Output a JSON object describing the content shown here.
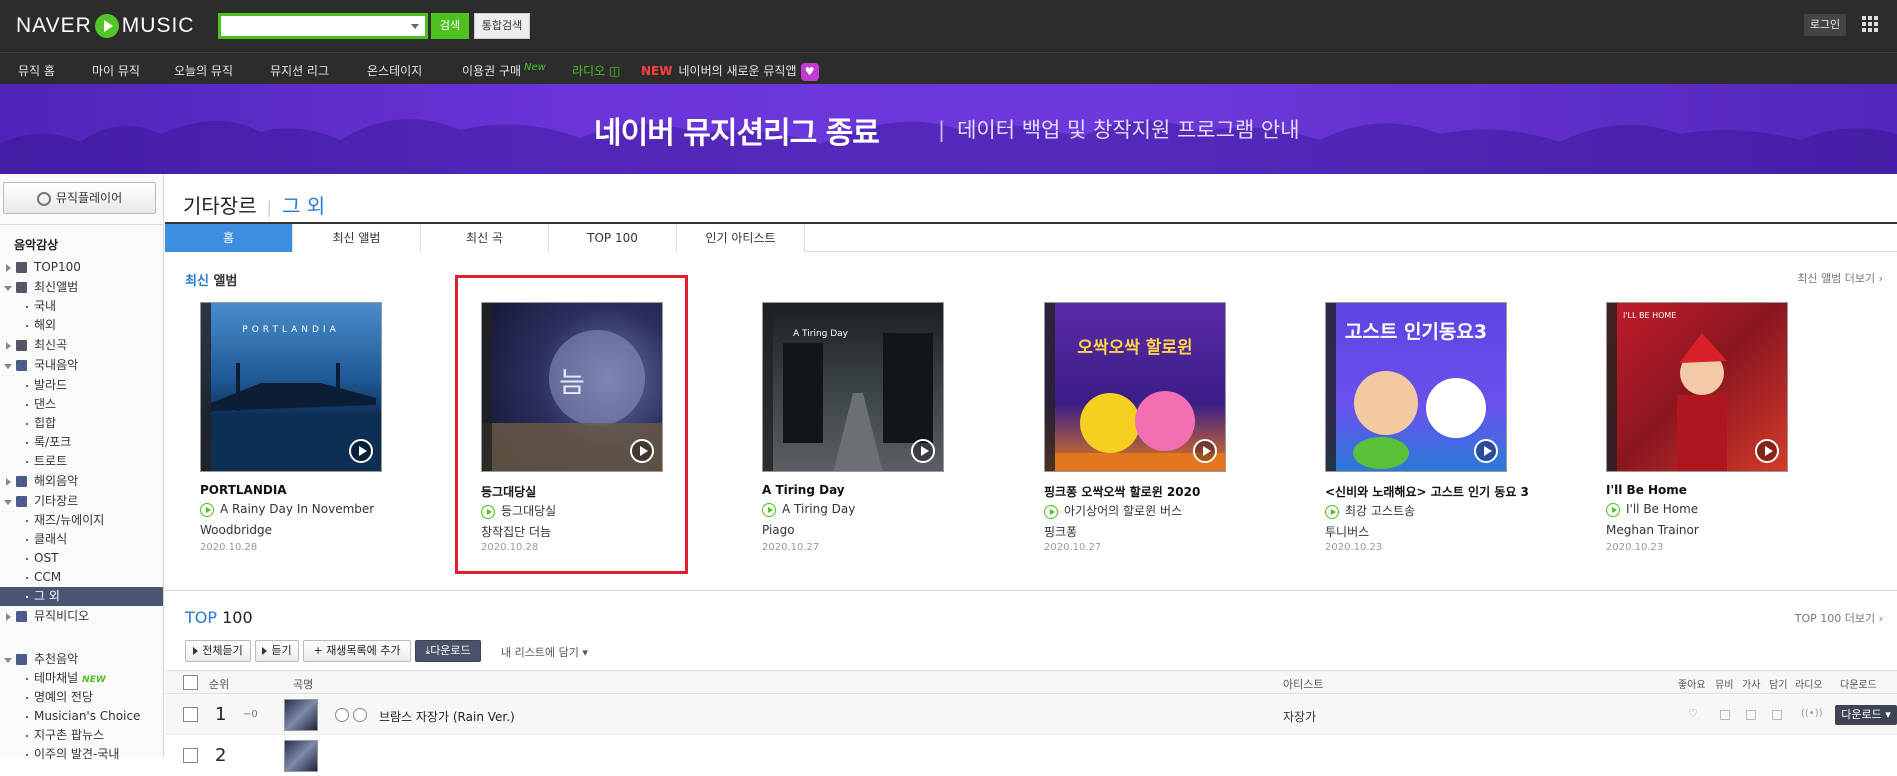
{
  "header": {
    "logo_left": "NAVER",
    "logo_right": "MUSIC",
    "search_placeholder": "",
    "search_btn": "검색",
    "total_search_btn": "통합검색",
    "login": "로그인"
  },
  "nav": {
    "items": [
      "뮤직 홈",
      "마이 뮤직",
      "오늘의 뮤직",
      "뮤지션 리그",
      "온스테이지"
    ],
    "voucher": "이용권 구매",
    "voucher_new": "New",
    "radio": "라디오",
    "new_tag": "NEW",
    "new_app": "네이버의 새로운 뮤직앱"
  },
  "banner": {
    "title": "네이버 뮤지션리그 종료",
    "bar": "|",
    "subtitle": "데이터 백업 및 창작지원 프로그램 안내"
  },
  "sidebar": {
    "player_btn": "뮤직플레이어",
    "section_title": "음악감상",
    "items": [
      "TOP100",
      "최신앨범",
      "국내",
      "해외",
      "최신곡",
      "국내음악",
      "발라드",
      "댄스",
      "힙합",
      "록/포크",
      "트로트",
      "해외음악",
      "기타장르",
      "재즈/뉴에이지",
      "클래식",
      "OST",
      "CCM",
      "그 외",
      "뮤직비디오",
      "추천음악",
      "테마채널",
      "명예의 전당",
      "Musician's Choice",
      "지구촌 팝뉴스",
      "이주의 발견-국내"
    ],
    "new_badge": "NEW"
  },
  "page": {
    "genre": "기타장르",
    "sep": "|",
    "sub": "그 외"
  },
  "tabs": [
    "홈",
    "최신 앨범",
    "최신 곡",
    "TOP 100",
    "인기 아티스트"
  ],
  "latest": {
    "title_hl": "최신",
    "title": "앨범",
    "more": "최신 앨범 더보기 ›"
  },
  "albums": [
    {
      "title": "PORTLANDIA",
      "track": "A Rainy Day In November",
      "artist": "Woodbridge",
      "date": "2020.10.28",
      "cover_text": "PORTLANDIA"
    },
    {
      "title": "등그대당실",
      "track": "등그대당실",
      "artist": "창작집단 더늠",
      "date": "2020.10.28",
      "cover_text": "늠"
    },
    {
      "title": "A Tiring Day",
      "track": "A Tiring Day",
      "artist": "Piago",
      "date": "2020.10.27",
      "cover_text": "A Tiring Day"
    },
    {
      "title": "핑크퐁 오싹오싹 할로윈 2020",
      "track": "아기상어의 할로윈 버스",
      "artist": "핑크퐁",
      "date": "2020.10.27",
      "cover_text": "오싹오싹 할로윈"
    },
    {
      "title": "<신비와 노래해요> 고스트 인기 동요 3",
      "track": "최강 고스트송",
      "artist": "투니버스",
      "date": "2020.10.23",
      "cover_text": "고스트 인기동요3"
    },
    {
      "title": "I'll Be Home",
      "track": "I'll Be Home",
      "artist": "Meghan Trainor",
      "date": "2020.10.23",
      "cover_text": "I'LL BE HOME"
    }
  ],
  "top100": {
    "title_hl": "TOP",
    "title": "100",
    "more": "TOP 100 더보기 ›",
    "btn_all": "전체듣기",
    "btn_play": "듣기",
    "btn_add": "재생목록에 추가",
    "btn_download": "다운로드",
    "mylist": "내 리스트에 담기",
    "headers": {
      "rank": "순위",
      "song": "곡명",
      "artist": "아티스트",
      "like": "좋아요",
      "mv": "뮤비",
      "lyrics": "가사",
      "add": "담기",
      "radio": "라디오",
      "download": "다운로드"
    },
    "rows": [
      {
        "rank": "1",
        "change": "−0",
        "song": "브람스 자장가 (Rain Ver.)",
        "artist": "자장가",
        "download": "다운로드"
      },
      {
        "rank": "2",
        "change": "",
        "song": "",
        "artist": "",
        "download": ""
      }
    ]
  },
  "colors": {
    "accent": "#4dc21f",
    "blue": "#2a7ad5",
    "banner": "#6a34d8",
    "highlight": "#e0202a"
  }
}
